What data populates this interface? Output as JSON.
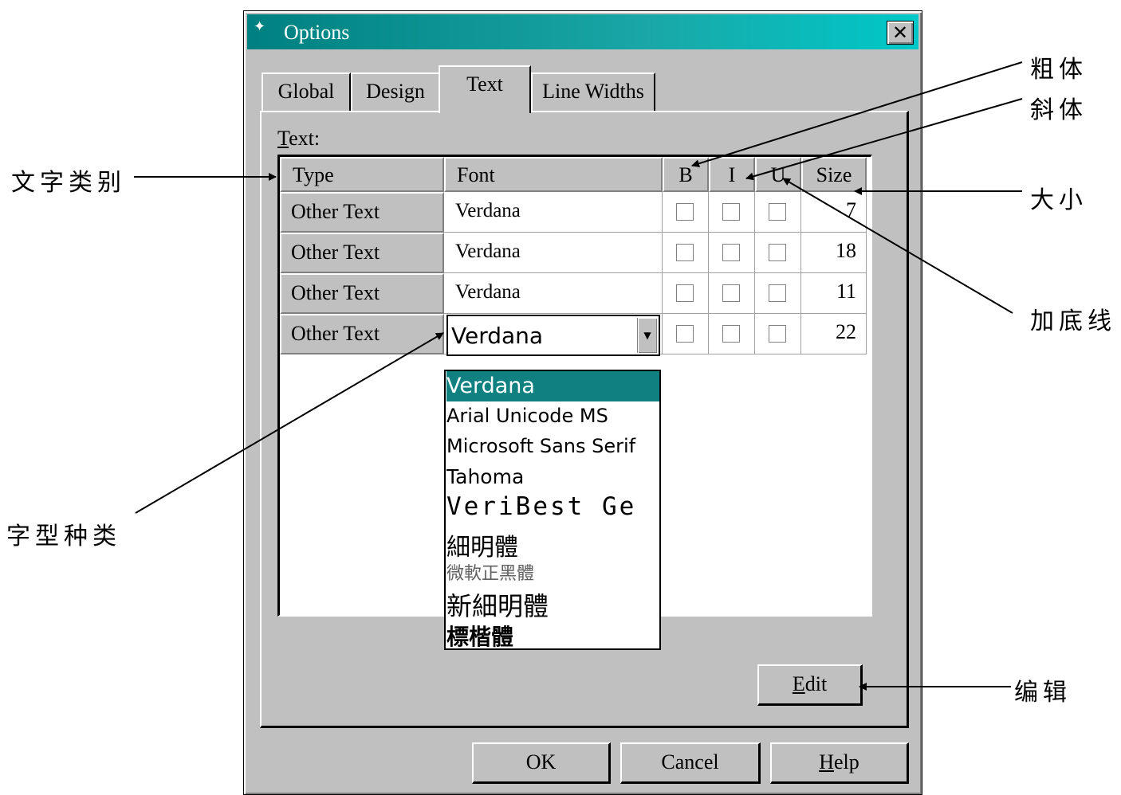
{
  "window": {
    "title": "Options",
    "close_glyph": "✕"
  },
  "tabs": [
    {
      "label": "Global",
      "active": false
    },
    {
      "label": "Design",
      "active": false
    },
    {
      "label": "Text",
      "active": true
    },
    {
      "label": "Line Widths",
      "active": false
    }
  ],
  "text_section": {
    "label_first": "T",
    "label_rest": "ext:"
  },
  "table": {
    "headers": {
      "type": "Type",
      "font": "Font",
      "bold": "B",
      "italic": "I",
      "underline": "U",
      "size": "Size"
    },
    "rows": [
      {
        "type": "Other Text",
        "font": "Verdana",
        "bold": false,
        "italic": false,
        "underline": false,
        "size": "7"
      },
      {
        "type": "Other Text",
        "font": "Verdana",
        "bold": false,
        "italic": false,
        "underline": false,
        "size": "18"
      },
      {
        "type": "Other Text",
        "font": "Verdana",
        "bold": false,
        "italic": false,
        "underline": false,
        "size": "11"
      },
      {
        "type": "Other Text",
        "font": "Verdana",
        "bold": false,
        "italic": false,
        "underline": false,
        "size": "22"
      }
    ]
  },
  "font_combo": {
    "value": "Verdana",
    "options": [
      "Verdana",
      "Arial Unicode MS",
      "Microsoft Sans Serif",
      "Tahoma",
      "VeriBest Ge",
      "細明體",
      "微軟正黑體",
      "新細明體",
      "標楷體"
    ],
    "selected_index": 0
  },
  "buttons": {
    "edit_first": "E",
    "edit_rest": "dit",
    "ok": "OK",
    "cancel": "Cancel",
    "help_first": "H",
    "help_rest": "elp"
  },
  "annotations": {
    "text_category": "文字类别",
    "font_type": "字型种类",
    "bold": "粗体",
    "italic": "斜体",
    "size": "大小",
    "underline": "加底线",
    "edit": "编辑"
  },
  "colors": {
    "face": "#c0c0c0",
    "titlebar": "#008080",
    "selection": "#108080"
  }
}
